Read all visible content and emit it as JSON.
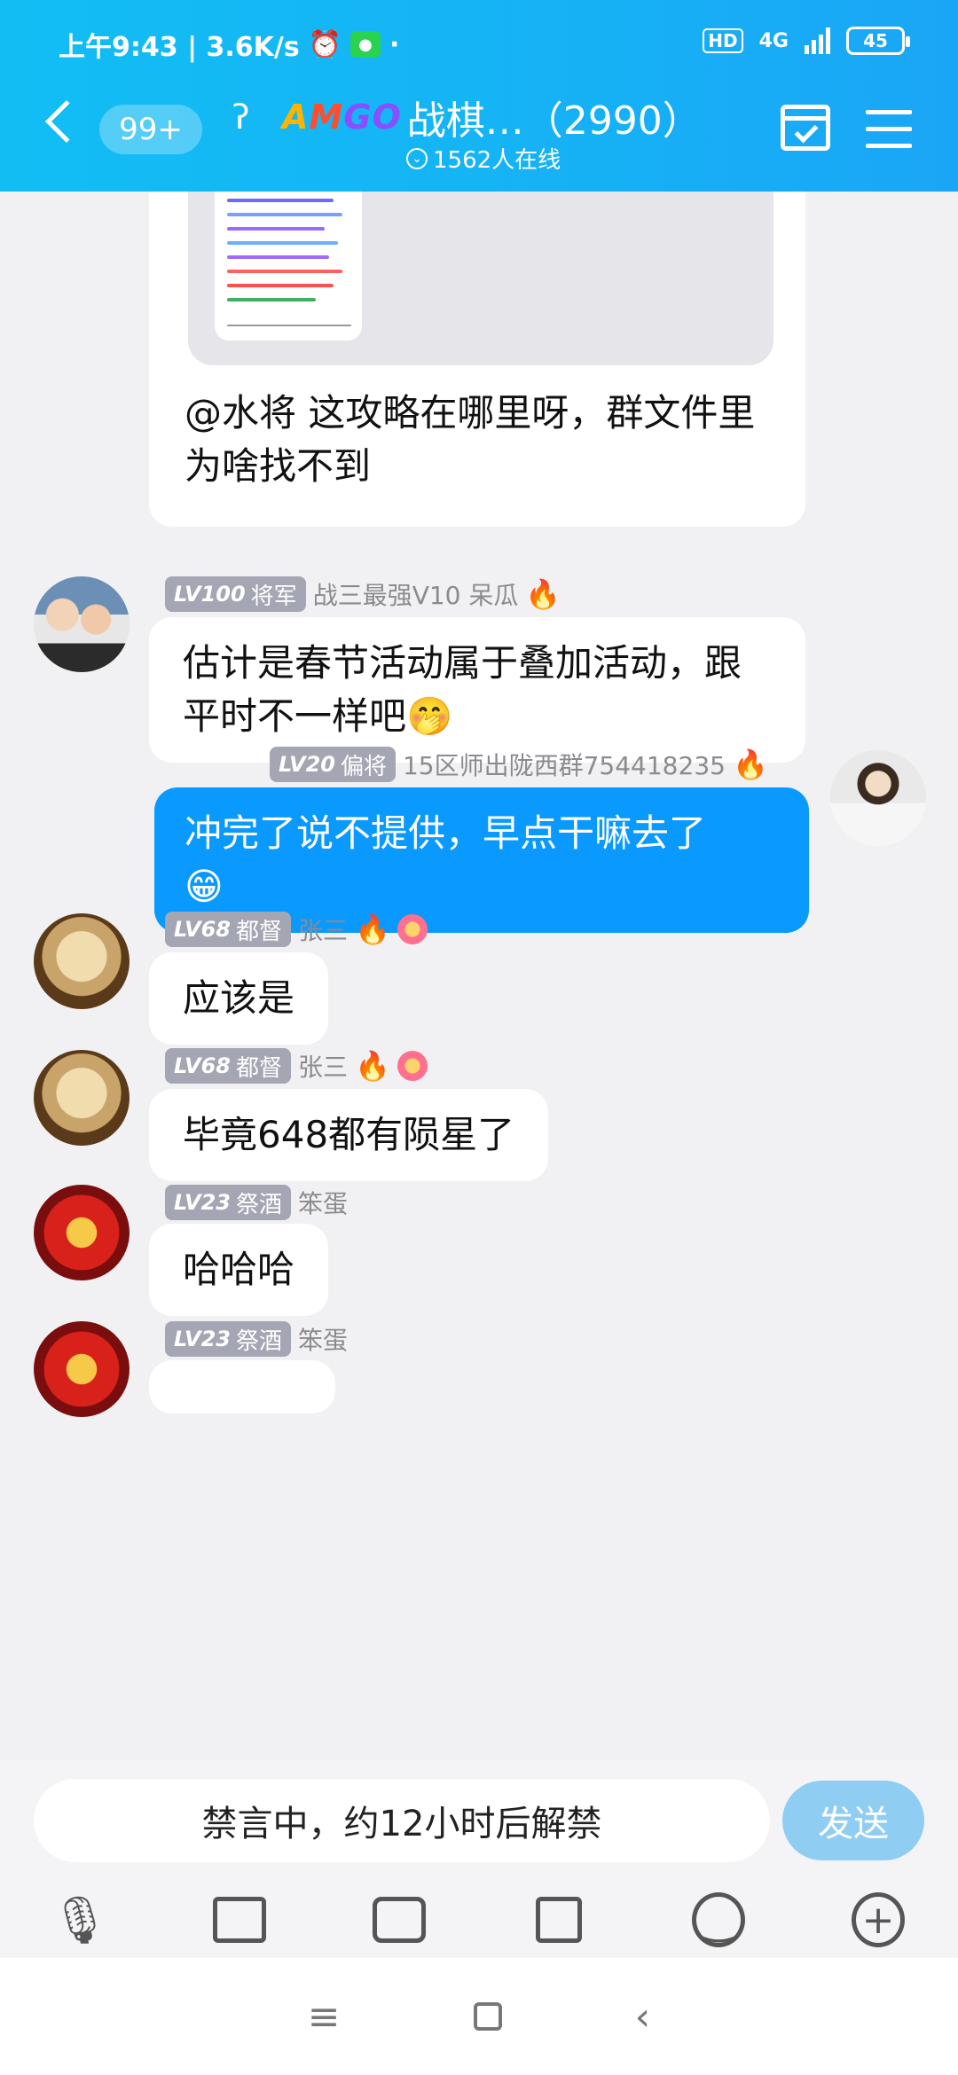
{
  "status_bar": {
    "time": "上午9:43 | 3.6K/s",
    "hd": "HD",
    "network": "4G",
    "battery": "45"
  },
  "header": {
    "unread_badge": "99+",
    "logo": "AMGO",
    "title": "战棋…（2990）",
    "online": "1562人在线"
  },
  "messages": [
    {
      "type": "image_card",
      "caption": "@水将 这攻略在哪里呀，群文件里为啥找不到"
    },
    {
      "level": "LV100",
      "rank": "将军",
      "name": "战三最强V10 呆瓜",
      "text": "估计是春节活动属于叠加活动，跟平时不一样吧",
      "emoji": "🤭"
    },
    {
      "self": true,
      "level": "LV20",
      "rank": "偏将",
      "name": "15区师出陇西群754418235",
      "text": "冲完了说不提供，早点干嘛去了",
      "emoji": "😁"
    },
    {
      "level": "LV68",
      "rank": "都督",
      "name": "张三",
      "text": "应该是"
    },
    {
      "level": "LV68",
      "rank": "都督",
      "name": "张三",
      "text": "毕竟648都有陨星了"
    },
    {
      "level": "LV23",
      "rank": "祭酒",
      "name": "笨蛋",
      "text": "哈哈哈"
    },
    {
      "level": "LV23",
      "rank": "祭酒",
      "name": "笨蛋",
      "text": ""
    }
  ],
  "input": {
    "placeholder": "禁言中，约12小时后解禁",
    "send_label": "发送"
  },
  "icons": [
    "mic-icon",
    "image-icon",
    "camera-icon",
    "file-icon",
    "emoji-icon",
    "plus-icon"
  ]
}
